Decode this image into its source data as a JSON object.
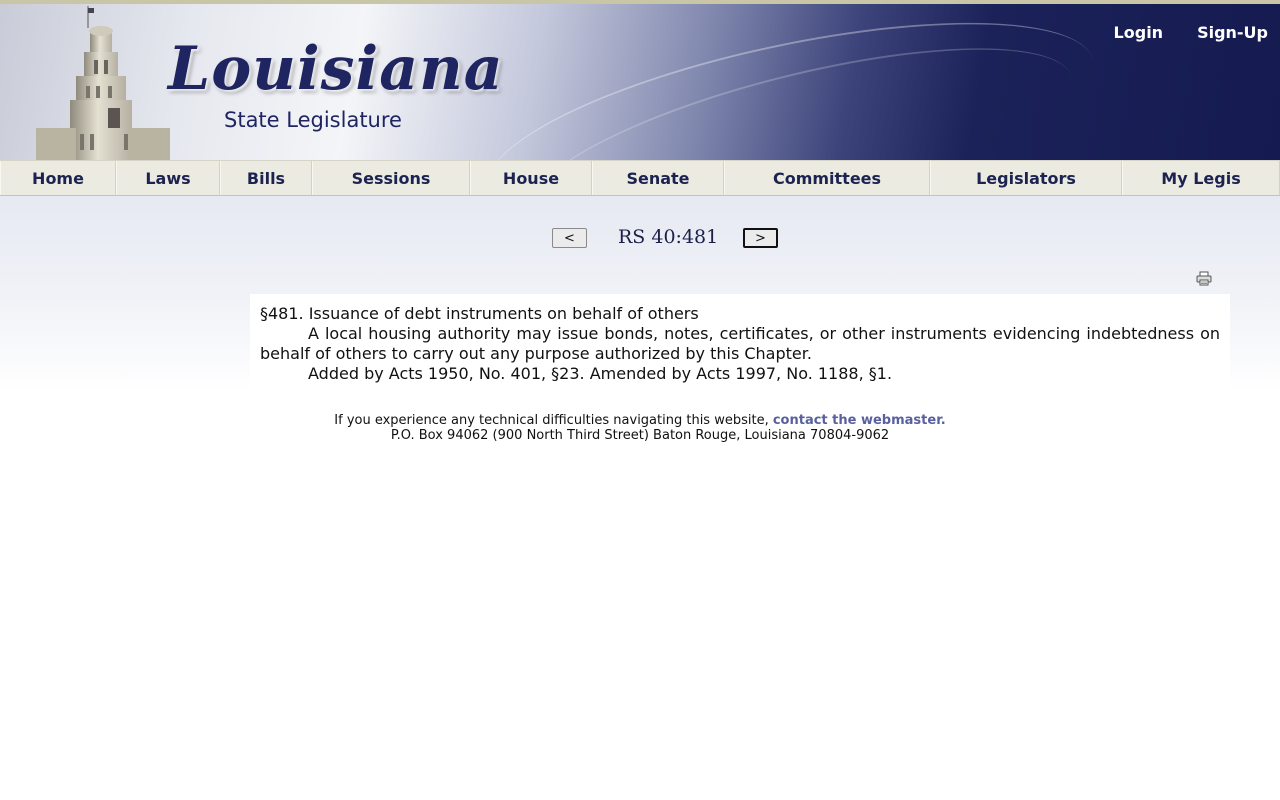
{
  "header": {
    "logo_title": "Louisiana",
    "logo_subtitle": "State Legislature",
    "login_label": "Login",
    "signup_label": "Sign-Up"
  },
  "nav": {
    "items": [
      {
        "label": "Home"
      },
      {
        "label": "Laws"
      },
      {
        "label": "Bills"
      },
      {
        "label": "Sessions"
      },
      {
        "label": "House"
      },
      {
        "label": "Senate"
      },
      {
        "label": "Committees"
      },
      {
        "label": "Legislators"
      },
      {
        "label": "My Legis"
      }
    ]
  },
  "pager": {
    "prev_label": "<",
    "next_label": ">",
    "title": "RS 40:481"
  },
  "icons": {
    "print": "printer-icon"
  },
  "law": {
    "heading": "§481.  Issuance of debt instruments on behalf of others",
    "body": "A local housing authority may issue bonds, notes, certificates, or other instruments evidencing indebtedness on behalf of others to carry out any purpose authorized by this Chapter.",
    "history": "Added by Acts 1950, No. 401, §23.  Amended by Acts 1997, No. 1188, §1."
  },
  "footer": {
    "text": "If you experience any technical difficulties navigating this website,",
    "link_label": "contact the webmaster.",
    "address": "P.O. Box 94062 (900 North Third Street) Baton Rouge, Louisiana 70804-9062"
  },
  "colors": {
    "brand_navy": "#1e2560",
    "nav_bg": "#ecebe2",
    "link": "#5a5f9e"
  }
}
